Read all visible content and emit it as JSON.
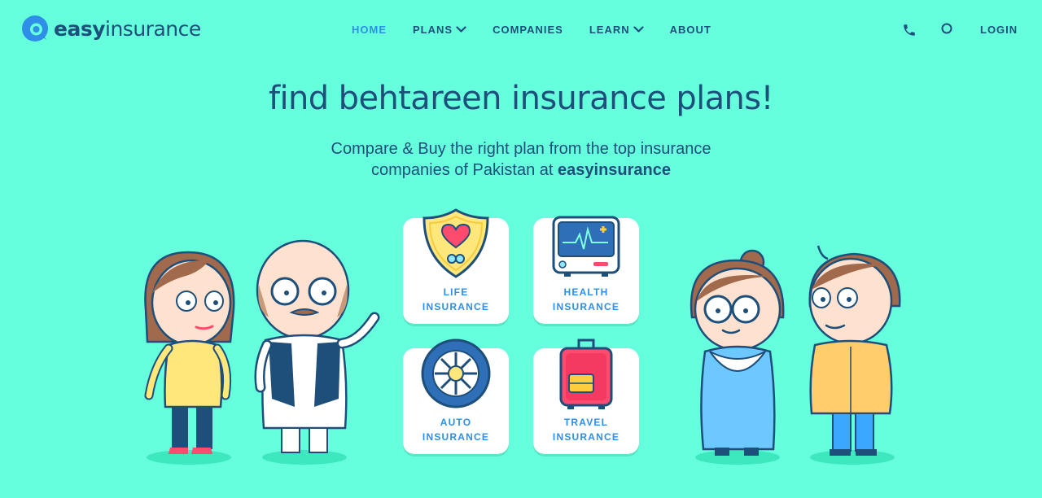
{
  "brand": {
    "logo_part1": "easy",
    "logo_part2": "insurance"
  },
  "nav": {
    "items": [
      {
        "label": "HOME",
        "active": true
      },
      {
        "label": "PLANS",
        "dropdown": true
      },
      {
        "label": "COMPANIES"
      },
      {
        "label": "LEARN",
        "dropdown": true
      },
      {
        "label": "ABOUT"
      }
    ],
    "login_label": "LOGIN",
    "icons": [
      "phone-icon",
      "search-icon"
    ]
  },
  "hero": {
    "title": "find behtareen insurance plans!",
    "subtitle_line1": "Compare & Buy the right plan from the top insurance",
    "subtitle_line2_prefix": "companies of Pakistan at",
    "subtitle_brand": "easyinsurance"
  },
  "cards": [
    {
      "line1": "LIFE",
      "line2": "INSURANCE",
      "icon": "shield-heart-icon"
    },
    {
      "line1": "HEALTH",
      "line2": "INSURANCE",
      "icon": "heart-monitor-icon"
    },
    {
      "line1": "AUTO",
      "line2": "INSURANCE",
      "icon": "wheel-icon"
    },
    {
      "line1": "TRAVEL",
      "line2": "INSURANCE",
      "icon": "suitcase-icon"
    }
  ],
  "colors": {
    "background": "#66ffdd",
    "navy": "#1d4f7a",
    "accent_blue": "#2e8ee8",
    "card_bg": "#ffffff"
  }
}
